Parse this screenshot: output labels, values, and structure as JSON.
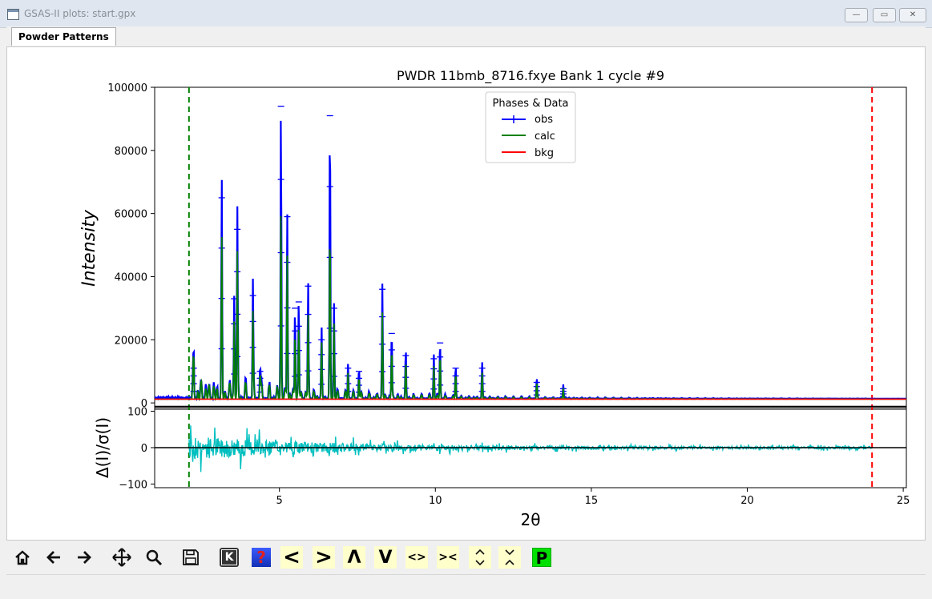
{
  "window": {
    "title": "GSAS-II plots: start.gpx"
  },
  "tabs": [
    {
      "label": "Powder Patterns"
    }
  ],
  "chart_data": {
    "type": "line",
    "title": "PWDR 11bmb_8716.fxye Bank 1 cycle #9",
    "xlabel": "2θ",
    "ylabel": "Intensity",
    "ylabel_residual": "Δ(I)/σ(I)",
    "xlim": [
      1,
      25.1
    ],
    "ylim": [
      -2000,
      100000
    ],
    "ylim_residual": [
      -110,
      110
    ],
    "x_ticks": [
      "5",
      "10",
      "15",
      "20",
      "25"
    ],
    "y_ticks": [
      "0",
      "20000",
      "40000",
      "60000",
      "80000",
      "100000"
    ],
    "residual_ticks": [
      "100",
      "0",
      "−100"
    ],
    "limit_lines": {
      "low": 2.1,
      "high": 24.0
    },
    "legend": {
      "title": "Phases & Data",
      "position": "top-center"
    },
    "series": [
      {
        "name": "obs",
        "color": "#0000ff"
      },
      {
        "name": "calc",
        "color": "#008000"
      },
      {
        "name": "bkg",
        "color": "#ff0000"
      }
    ],
    "peaks": [
      {
        "x": 2.25,
        "obs": 11000,
        "calc": 9000
      },
      {
        "x": 3.15,
        "obs": 65000,
        "calc": 47000
      },
      {
        "x": 3.55,
        "obs": 33000,
        "calc": 25000
      },
      {
        "x": 3.65,
        "obs": 55000,
        "calc": 42000
      },
      {
        "x": 4.15,
        "obs": 34000,
        "calc": 24000
      },
      {
        "x": 4.38,
        "obs": 10000,
        "calc": 8000
      },
      {
        "x": 5.05,
        "obs": 94000,
        "calc": 62000
      },
      {
        "x": 5.25,
        "obs": 59000,
        "calc": 46000
      },
      {
        "x": 5.5,
        "obs": 30000,
        "calc": 22000
      },
      {
        "x": 5.62,
        "obs": 32000,
        "calc": 24000
      },
      {
        "x": 5.92,
        "obs": 37000,
        "calc": 27000
      },
      {
        "x": 6.35,
        "obs": 20000,
        "calc": 16000
      },
      {
        "x": 6.62,
        "obs": 91000,
        "calc": 55000
      },
      {
        "x": 6.75,
        "obs": 30000,
        "calc": 24000
      },
      {
        "x": 7.2,
        "obs": 11000,
        "calc": 8500
      },
      {
        "x": 7.55,
        "obs": 10000,
        "calc": 7500
      },
      {
        "x": 8.3,
        "obs": 36000,
        "calc": 27000
      },
      {
        "x": 8.6,
        "obs": 22000,
        "calc": 17000
      },
      {
        "x": 9.05,
        "obs": 15000,
        "calc": 11000
      },
      {
        "x": 9.95,
        "obs": 14000,
        "calc": 10500
      },
      {
        "x": 10.15,
        "obs": 19000,
        "calc": 15000
      },
      {
        "x": 10.65,
        "obs": 11000,
        "calc": 8500
      },
      {
        "x": 11.5,
        "obs": 11000,
        "calc": 8000
      },
      {
        "x": 13.25,
        "obs": 6500,
        "calc": 5000
      },
      {
        "x": 14.1,
        "obs": 4500,
        "calc": 3500
      }
    ],
    "background_level": 1200,
    "toolbar": {
      "key_label": "K",
      "help_label": "?",
      "shift_left": "<",
      "shift_right": ">",
      "up": "Λ",
      "down": "V",
      "expand_x": "<>",
      "contract_x": "><",
      "expand_y": "^v",
      "contract_y": "v^",
      "publish": "P"
    }
  }
}
